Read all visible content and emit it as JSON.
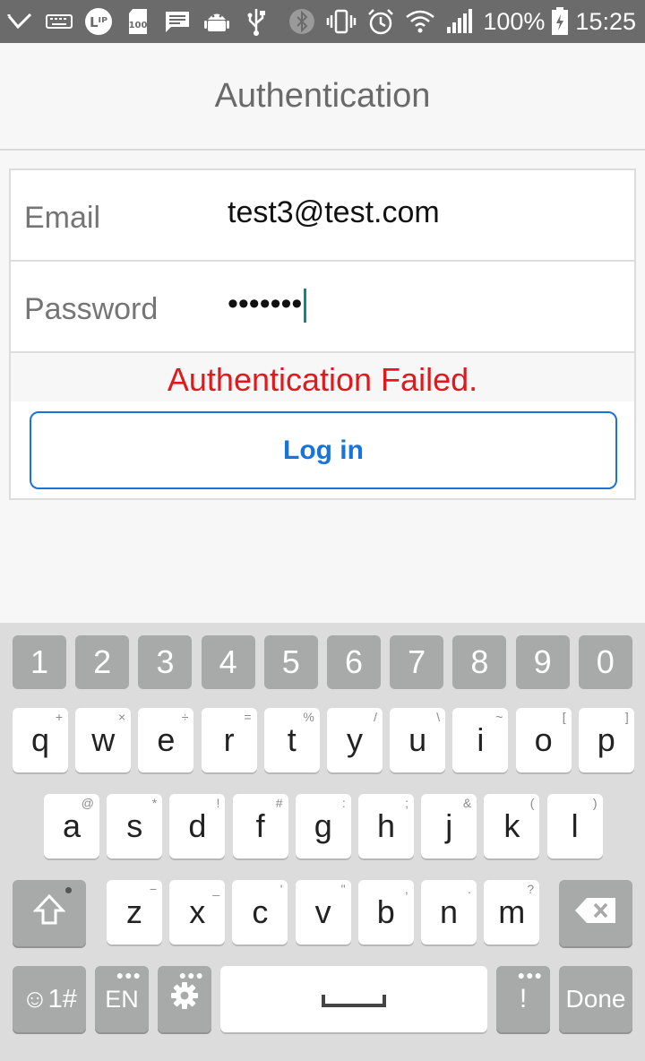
{
  "status_bar": {
    "battery_percent": "100%",
    "time": "15:25",
    "icons": [
      "check-icon",
      "keyboard-icon",
      "signal-badge-icon",
      "sd-100-icon",
      "message-icon",
      "android-icon",
      "usb-icon",
      "bluetooth-icon",
      "vibrate-icon",
      "alarm-icon",
      "wifi-icon",
      "cell-signal-icon",
      "battery-icon"
    ]
  },
  "header": {
    "title": "Authentication"
  },
  "form": {
    "email_label": "Email",
    "email_value": "test3@test.com",
    "password_label": "Password",
    "password_value": "•••••••",
    "error_message": "Authentication Failed.",
    "login_label": "Log in"
  },
  "keyboard": {
    "numbers": [
      "1",
      "2",
      "3",
      "4",
      "5",
      "6",
      "7",
      "8",
      "9",
      "0"
    ],
    "row1": [
      {
        "k": "q",
        "s": "+"
      },
      {
        "k": "w",
        "s": "×"
      },
      {
        "k": "e",
        "s": "÷"
      },
      {
        "k": "r",
        "s": "="
      },
      {
        "k": "t",
        "s": "%"
      },
      {
        "k": "y",
        "s": "/"
      },
      {
        "k": "u",
        "s": "\\"
      },
      {
        "k": "i",
        "s": "~"
      },
      {
        "k": "o",
        "s": "["
      },
      {
        "k": "p",
        "s": "]"
      }
    ],
    "row2": [
      {
        "k": "a",
        "s": "@"
      },
      {
        "k": "s",
        "s": "*"
      },
      {
        "k": "d",
        "s": "!"
      },
      {
        "k": "f",
        "s": "#"
      },
      {
        "k": "g",
        "s": ":"
      },
      {
        "k": "h",
        "s": ";"
      },
      {
        "k": "j",
        "s": "&"
      },
      {
        "k": "k",
        "s": "("
      },
      {
        "k": "l",
        "s": ")"
      }
    ],
    "row3": [
      {
        "k": "z",
        "s": "−"
      },
      {
        "k": "x",
        "s": "_"
      },
      {
        "k": "c",
        "s": "'"
      },
      {
        "k": "v",
        "s": "\""
      },
      {
        "k": "b",
        "s": ","
      },
      {
        "k": "n",
        "s": "."
      },
      {
        "k": "m",
        "s": "?"
      }
    ],
    "symbols_label": "☺1#",
    "lang_label": "EN",
    "exclaim_label": "!",
    "done_label": "Done",
    "shift_icon": "shift-icon",
    "backspace_icon": "backspace-icon",
    "settings_icon": "gear-icon",
    "space_icon": "space-icon"
  }
}
